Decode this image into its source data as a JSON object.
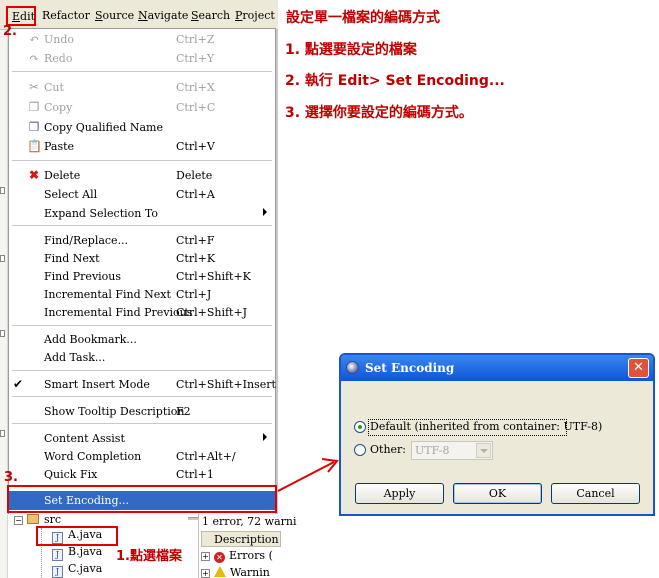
{
  "menubar": {
    "items": [
      "Edit",
      "Refactor",
      "Source",
      "Navigate",
      "Search",
      "Project"
    ]
  },
  "menu": {
    "undo": {
      "label": "Undo",
      "accel": "Ctrl+Z"
    },
    "redo": {
      "label": "Redo",
      "accel": "Ctrl+Y"
    },
    "cut": {
      "label": "Cut",
      "accel": "Ctrl+X"
    },
    "copy": {
      "label": "Copy",
      "accel": "Ctrl+C"
    },
    "copy_qualified": {
      "label": "Copy Qualified Name"
    },
    "paste": {
      "label": "Paste",
      "accel": "Ctrl+V"
    },
    "delete": {
      "label": "Delete",
      "accel": "Delete"
    },
    "select_all": {
      "label": "Select All",
      "accel": "Ctrl+A"
    },
    "expand_selection": {
      "label": "Expand Selection To"
    },
    "find_replace": {
      "label": "Find/Replace...",
      "accel": "Ctrl+F"
    },
    "find_next": {
      "label": "Find Next",
      "accel": "Ctrl+K"
    },
    "find_previous": {
      "label": "Find Previous",
      "accel": "Ctrl+Shift+K"
    },
    "inc_find_next": {
      "label": "Incremental Find Next",
      "accel": "Ctrl+J"
    },
    "inc_find_previous": {
      "label": "Incremental Find Previous",
      "accel": "Ctrl+Shift+J"
    },
    "add_bookmark": {
      "label": "Add Bookmark..."
    },
    "add_task": {
      "label": "Add Task..."
    },
    "smart_insert": {
      "label": "Smart Insert Mode",
      "accel": "Ctrl+Shift+Insert",
      "checked": true
    },
    "show_tooltip": {
      "label": "Show Tooltip Description",
      "accel": "F2"
    },
    "content_assist": {
      "label": "Content Assist"
    },
    "word_completion": {
      "label": "Word Completion",
      "accel": "Ctrl+Alt+/"
    },
    "quick_fix": {
      "label": "Quick Fix",
      "accel": "Ctrl+1"
    },
    "set_encoding": {
      "label": "Set Encoding..."
    }
  },
  "tree": {
    "src": "src",
    "files": [
      "A.java",
      "B.java",
      "C.java"
    ]
  },
  "problems": {
    "summary": "1 error, 72 warni",
    "column": "Description",
    "errors": "Errors (",
    "warnings": "Warnin"
  },
  "annotations": {
    "title": "設定單一檔案的編碼方式",
    "step1": "1. 點選要設定的檔案",
    "step2": "2. 執行 Edit> Set Encoding...",
    "step3": "3. 選擇你要設定的編碼方式。",
    "marker2": "2.",
    "marker3": "3.",
    "marker1": "1.點選檔案"
  },
  "dialog": {
    "title": "Set Encoding",
    "default_label": "Default (inherited from container: UTF-8)",
    "other_label": "Other:",
    "other_value": "UTF-8",
    "apply": "Apply",
    "ok": "OK",
    "cancel": "Cancel",
    "selected": "default"
  },
  "colors": {
    "annotation": "#c00000",
    "highlight_box": "#e00000",
    "selection": "#316ac5",
    "dialog_title": "#0c55d8"
  }
}
